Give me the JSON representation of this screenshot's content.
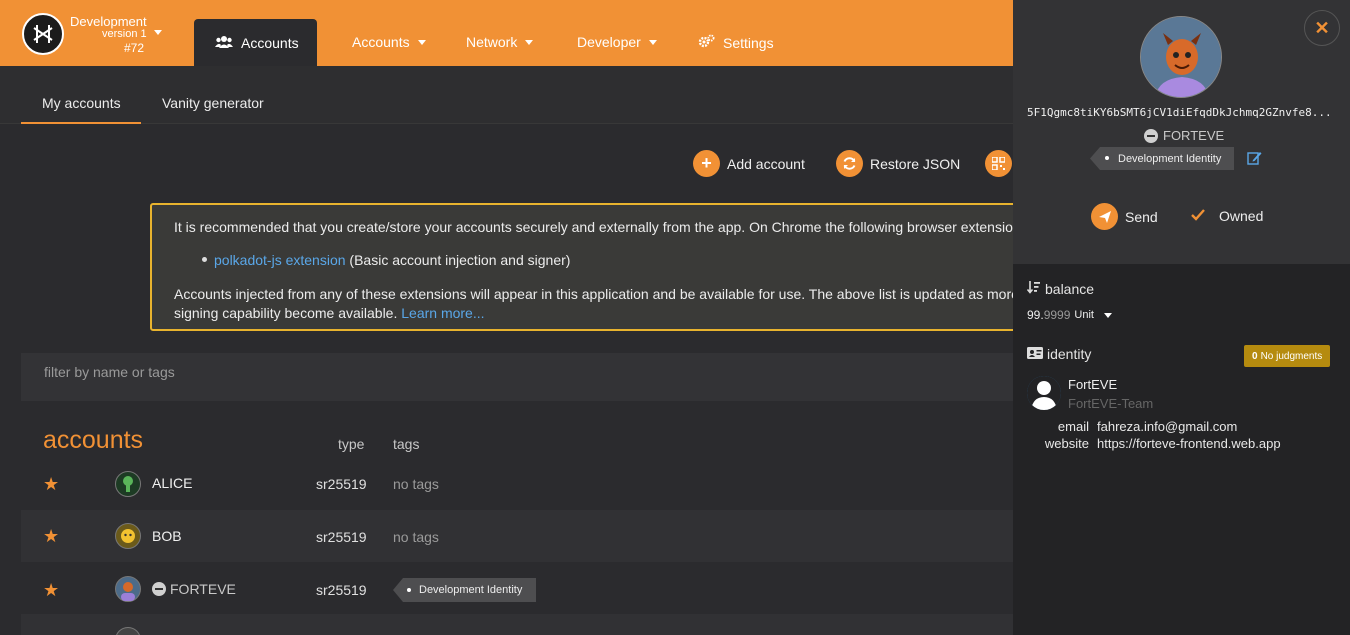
{
  "chain": {
    "name": "Development",
    "version": "version 1",
    "block": "#72"
  },
  "nav": {
    "active": "Accounts",
    "items": [
      {
        "label": "Accounts",
        "has_caret": true
      },
      {
        "label": "Network",
        "has_caret": true
      },
      {
        "label": "Developer",
        "has_caret": true
      },
      {
        "label": "Settings",
        "has_caret": false
      }
    ]
  },
  "subtabs": [
    "My accounts",
    "Vanity generator"
  ],
  "actions": {
    "add": "Add account",
    "restore": "Restore JSON"
  },
  "notice": {
    "line1": "It is recommended that you create/store your accounts securely and externally from the app. On Chrome the following browser extensio",
    "bullet_link": "polkadot-js extension",
    "bullet_text": " (Basic account injection and signer)",
    "line3": "Accounts injected from any of these extensions will appear in this application and be available for use. The above list is updated as more",
    "line4": "signing capability become available. ",
    "learn_more": "Learn more..."
  },
  "filter": {
    "placeholder": "filter by name or tags"
  },
  "table": {
    "title": "accounts",
    "col_type": "type",
    "col_tags": "tags",
    "rows": [
      {
        "name": "ALICE",
        "type": "sr25519",
        "tags": "no tags"
      },
      {
        "name": "BOB",
        "type": "sr25519",
        "tags": "no tags"
      },
      {
        "name": "FORTEVE",
        "type": "sr25519",
        "tag_badge": "Development Identity"
      }
    ]
  },
  "panel": {
    "address": "5F1Qgmc8tiKY6bSMT6jCV1diEfqdDkJchmq2GZnvfe8...",
    "identity_name": "FORTEVE",
    "tag": "Development Identity",
    "send": "Send",
    "owned": "Owned",
    "balance_label": "balance",
    "balance_int": "99.",
    "balance_dec": "9999",
    "balance_unit": "Unit",
    "identity_label": "identity",
    "judgments": "No judgments",
    "judgments_count": "0",
    "display": "FortEVE",
    "legal": "FortEVE-Team",
    "email_k": "email",
    "email_v": "fahreza.info@gmail.com",
    "website_k": "website",
    "website_v": "https://forteve-frontend.web.app"
  },
  "colors": {
    "accent": "#f19135",
    "warning_border": "#e8b32e",
    "link": "#5aa7e8",
    "judgment": "#b58b0f"
  }
}
